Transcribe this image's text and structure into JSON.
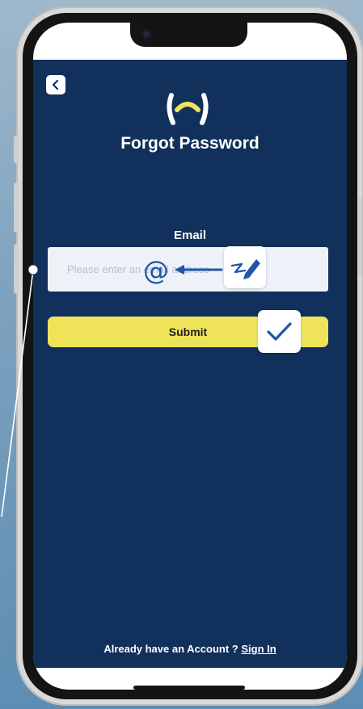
{
  "screen": {
    "title": "Forgot Password"
  },
  "back_button": {
    "icon": "chevron-left-icon"
  },
  "logo": {
    "icon": "app-logo",
    "colors": {
      "bracket": "#ffffff",
      "arc": "#efe459"
    }
  },
  "form": {
    "email_label": "Email",
    "email_value": "",
    "email_placeholder": "Please enter an email address",
    "submit_label": "Submit"
  },
  "footer": {
    "text": "Already have an Account ?",
    "link": "Sign In"
  },
  "overlays": {
    "at_icon": "@",
    "arrow_icon": "arrow-left-icon",
    "sign_icon": "signature-pen-icon",
    "check_icon": "checkmark-icon"
  },
  "colors": {
    "background": "#12305c",
    "accent": "#efe459",
    "input_bg": "#eef1f8",
    "icon_blue": "#1f56a6"
  }
}
